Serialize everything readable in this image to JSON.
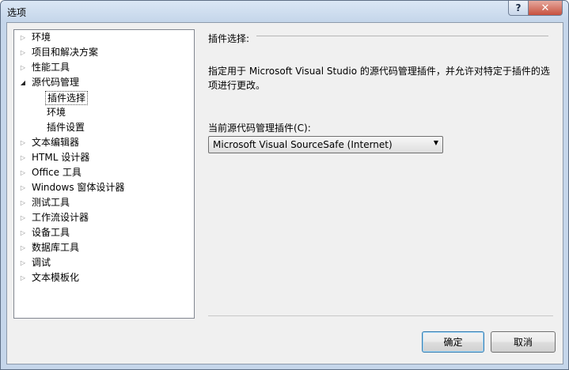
{
  "window": {
    "title": "选项",
    "help_label": "?",
    "close_label": "✕"
  },
  "tree": [
    {
      "label": "环境",
      "expanded": false
    },
    {
      "label": "项目和解决方案",
      "expanded": false
    },
    {
      "label": "性能工具",
      "expanded": false
    },
    {
      "label": "源代码管理",
      "expanded": true
    },
    {
      "label": "插件选择",
      "child": true,
      "selected": true
    },
    {
      "label": "环境",
      "child": true
    },
    {
      "label": "插件设置",
      "child": true
    },
    {
      "label": "文本编辑器",
      "expanded": false
    },
    {
      "label": "HTML 设计器",
      "expanded": false
    },
    {
      "label": "Office 工具",
      "expanded": false
    },
    {
      "label": "Windows 窗体设计器",
      "expanded": false
    },
    {
      "label": "测试工具",
      "expanded": false
    },
    {
      "label": "工作流设计器",
      "expanded": false
    },
    {
      "label": "设备工具",
      "expanded": false
    },
    {
      "label": "数据库工具",
      "expanded": false
    },
    {
      "label": "调试",
      "expanded": false
    },
    {
      "label": "文本模板化",
      "expanded": false
    }
  ],
  "panel": {
    "section_title": "插件选择:",
    "description": "指定用于 Microsoft Visual Studio 的源代码管理插件，并允许对特定于插件的选项进行更改。",
    "combo_label": "当前源代码管理插件(C):",
    "combo_value": "Microsoft Visual SourceSafe (Internet)"
  },
  "buttons": {
    "ok": "确定",
    "cancel": "取消"
  }
}
